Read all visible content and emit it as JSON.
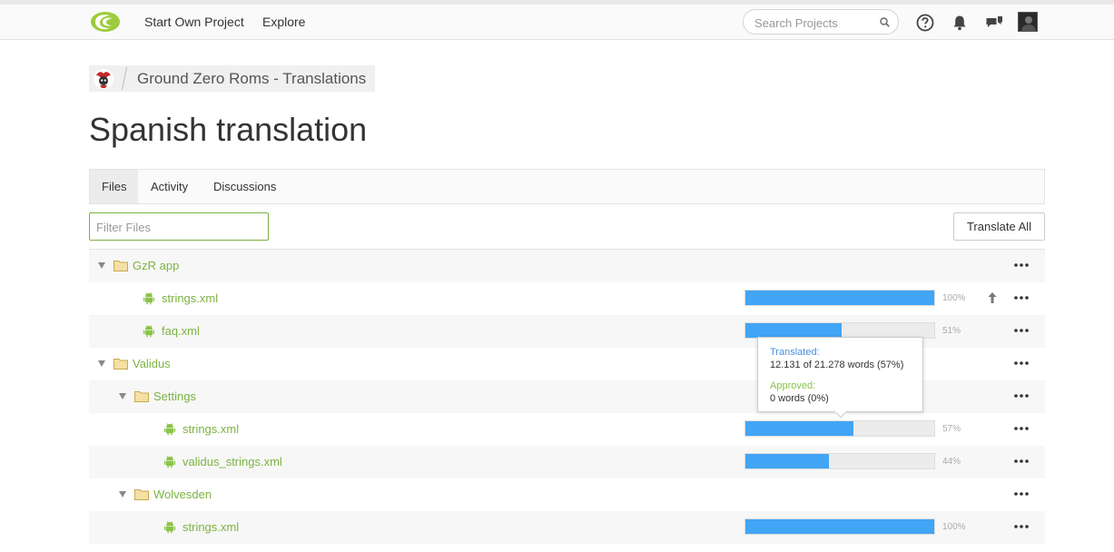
{
  "nav": {
    "start_project": "Start Own Project",
    "explore": "Explore",
    "search_placeholder": "Search Projects"
  },
  "breadcrumb": {
    "project": "Ground Zero Roms - Translations"
  },
  "page_title": "Spanish translation",
  "tabs": [
    {
      "label": "Files",
      "active": true
    },
    {
      "label": "Activity",
      "active": false
    },
    {
      "label": "Discussions",
      "active": false
    }
  ],
  "filter": {
    "placeholder": "Filter Files"
  },
  "translate_all": "Translate All",
  "tree": [
    {
      "type": "folder",
      "level": 0,
      "name": "GzR app"
    },
    {
      "type": "file",
      "level": 1,
      "name": "strings.xml",
      "progress": 100,
      "progress_label": "100%",
      "upload": true
    },
    {
      "type": "file",
      "level": 1,
      "name": "faq.xml",
      "progress": 51,
      "progress_label": "51%"
    },
    {
      "type": "folder",
      "level": 0,
      "name": "Validus"
    },
    {
      "type": "folder",
      "level": 1,
      "name": "Settings"
    },
    {
      "type": "file",
      "level": 2,
      "name": "strings.xml",
      "progress": 57,
      "progress_label": "57%"
    },
    {
      "type": "file",
      "level": 2,
      "name": "validus_strings.xml",
      "progress": 44,
      "progress_label": "44%"
    },
    {
      "type": "folder",
      "level": 1,
      "name": "Wolvesden"
    },
    {
      "type": "file",
      "level": 2,
      "name": "strings.xml",
      "progress": 100,
      "progress_label": "100%"
    }
  ],
  "tooltip": {
    "translated_label": "Translated:",
    "translated_value": "12.131 of 21.278 words (57%)",
    "approved_label": "Approved:",
    "approved_value": "0 words (0%)"
  },
  "colors": {
    "accent_green": "#7cb342",
    "progress_blue": "#42a5f5",
    "translated_blue": "#4a90d9",
    "approved_green": "#8bc34a"
  },
  "icons": {
    "logo": "crowdin-logo-icon",
    "search": "search-icon",
    "help": "help-icon",
    "notifications": "bell-icon",
    "messages": "chat-icon",
    "folder": "folder-icon",
    "file": "android-file-icon",
    "upload": "upload-arrow-icon",
    "more": "more-dots-icon"
  }
}
